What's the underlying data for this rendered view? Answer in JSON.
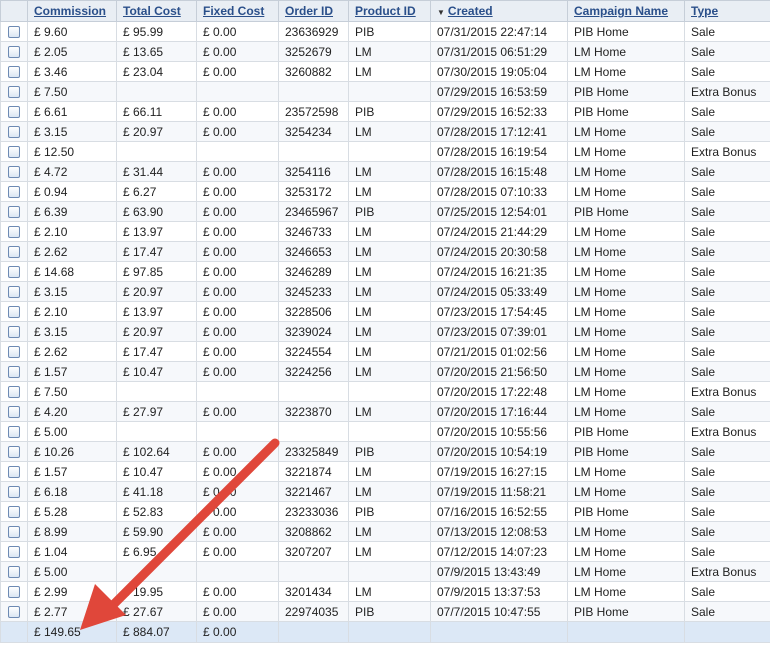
{
  "headers": {
    "commission": "Commission",
    "total_cost": "Total Cost",
    "fixed_cost": "Fixed Cost",
    "order_id": "Order ID",
    "product_id": "Product ID",
    "created": "Created",
    "campaign_name": "Campaign Name",
    "type": "Type"
  },
  "rows": [
    {
      "commission": "£ 9.60",
      "total_cost": "£ 95.99",
      "fixed_cost": "£ 0.00",
      "order_id": "23636929",
      "product_id": "PIB",
      "created": "07/31/2015 22:47:14",
      "campaign": "PIB Home",
      "type": "Sale"
    },
    {
      "commission": "£ 2.05",
      "total_cost": "£ 13.65",
      "fixed_cost": "£ 0.00",
      "order_id": "3252679",
      "product_id": "LM",
      "created": "07/31/2015 06:51:29",
      "campaign": "LM Home",
      "type": "Sale"
    },
    {
      "commission": "£ 3.46",
      "total_cost": "£ 23.04",
      "fixed_cost": "£ 0.00",
      "order_id": "3260882",
      "product_id": "LM",
      "created": "07/30/2015 19:05:04",
      "campaign": "LM Home",
      "type": "Sale"
    },
    {
      "commission": "£ 7.50",
      "total_cost": "",
      "fixed_cost": "",
      "order_id": "",
      "product_id": "",
      "created": "07/29/2015 16:53:59",
      "campaign": "PIB Home",
      "type": "Extra Bonus"
    },
    {
      "commission": "£ 6.61",
      "total_cost": "£ 66.11",
      "fixed_cost": "£ 0.00",
      "order_id": "23572598",
      "product_id": "PIB",
      "created": "07/29/2015 16:52:33",
      "campaign": "PIB Home",
      "type": "Sale"
    },
    {
      "commission": "£ 3.15",
      "total_cost": "£ 20.97",
      "fixed_cost": "£ 0.00",
      "order_id": "3254234",
      "product_id": "LM",
      "created": "07/28/2015 17:12:41",
      "campaign": "LM Home",
      "type": "Sale"
    },
    {
      "commission": "£ 12.50",
      "total_cost": "",
      "fixed_cost": "",
      "order_id": "",
      "product_id": "",
      "created": "07/28/2015 16:19:54",
      "campaign": "LM Home",
      "type": "Extra Bonus"
    },
    {
      "commission": "£ 4.72",
      "total_cost": "£ 31.44",
      "fixed_cost": "£ 0.00",
      "order_id": "3254116",
      "product_id": "LM",
      "created": "07/28/2015 16:15:48",
      "campaign": "LM Home",
      "type": "Sale"
    },
    {
      "commission": "£ 0.94",
      "total_cost": "£ 6.27",
      "fixed_cost": "£ 0.00",
      "order_id": "3253172",
      "product_id": "LM",
      "created": "07/28/2015 07:10:33",
      "campaign": "LM Home",
      "type": "Sale"
    },
    {
      "commission": "£ 6.39",
      "total_cost": "£ 63.90",
      "fixed_cost": "£ 0.00",
      "order_id": "23465967",
      "product_id": "PIB",
      "created": "07/25/2015 12:54:01",
      "campaign": "PIB Home",
      "type": "Sale"
    },
    {
      "commission": "£ 2.10",
      "total_cost": "£ 13.97",
      "fixed_cost": "£ 0.00",
      "order_id": "3246733",
      "product_id": "LM",
      "created": "07/24/2015 21:44:29",
      "campaign": "LM Home",
      "type": "Sale"
    },
    {
      "commission": "£ 2.62",
      "total_cost": "£ 17.47",
      "fixed_cost": "£ 0.00",
      "order_id": "3246653",
      "product_id": "LM",
      "created": "07/24/2015 20:30:58",
      "campaign": "LM Home",
      "type": "Sale"
    },
    {
      "commission": "£ 14.68",
      "total_cost": "£ 97.85",
      "fixed_cost": "£ 0.00",
      "order_id": "3246289",
      "product_id": "LM",
      "created": "07/24/2015 16:21:35",
      "campaign": "LM Home",
      "type": "Sale"
    },
    {
      "commission": "£ 3.15",
      "total_cost": "£ 20.97",
      "fixed_cost": "£ 0.00",
      "order_id": "3245233",
      "product_id": "LM",
      "created": "07/24/2015 05:33:49",
      "campaign": "LM Home",
      "type": "Sale"
    },
    {
      "commission": "£ 2.10",
      "total_cost": "£ 13.97",
      "fixed_cost": "£ 0.00",
      "order_id": "3228506",
      "product_id": "LM",
      "created": "07/23/2015 17:54:45",
      "campaign": "LM Home",
      "type": "Sale"
    },
    {
      "commission": "£ 3.15",
      "total_cost": "£ 20.97",
      "fixed_cost": "£ 0.00",
      "order_id": "3239024",
      "product_id": "LM",
      "created": "07/23/2015 07:39:01",
      "campaign": "LM Home",
      "type": "Sale"
    },
    {
      "commission": "£ 2.62",
      "total_cost": "£ 17.47",
      "fixed_cost": "£ 0.00",
      "order_id": "3224554",
      "product_id": "LM",
      "created": "07/21/2015 01:02:56",
      "campaign": "LM Home",
      "type": "Sale"
    },
    {
      "commission": "£ 1.57",
      "total_cost": "£ 10.47",
      "fixed_cost": "£ 0.00",
      "order_id": "3224256",
      "product_id": "LM",
      "created": "07/20/2015 21:56:50",
      "campaign": "LM Home",
      "type": "Sale"
    },
    {
      "commission": "£ 7.50",
      "total_cost": "",
      "fixed_cost": "",
      "order_id": "",
      "product_id": "",
      "created": "07/20/2015 17:22:48",
      "campaign": "LM Home",
      "type": "Extra Bonus"
    },
    {
      "commission": "£ 4.20",
      "total_cost": "£ 27.97",
      "fixed_cost": "£ 0.00",
      "order_id": "3223870",
      "product_id": "LM",
      "created": "07/20/2015 17:16:44",
      "campaign": "LM Home",
      "type": "Sale"
    },
    {
      "commission": "£ 5.00",
      "total_cost": "",
      "fixed_cost": "",
      "order_id": "",
      "product_id": "",
      "created": "07/20/2015 10:55:56",
      "campaign": "PIB Home",
      "type": "Extra Bonus"
    },
    {
      "commission": "£ 10.26",
      "total_cost": "£ 102.64",
      "fixed_cost": "£ 0.00",
      "order_id": "23325849",
      "product_id": "PIB",
      "created": "07/20/2015 10:54:19",
      "campaign": "PIB Home",
      "type": "Sale"
    },
    {
      "commission": "£ 1.57",
      "total_cost": "£ 10.47",
      "fixed_cost": "£ 0.00",
      "order_id": "3221874",
      "product_id": "LM",
      "created": "07/19/2015 16:27:15",
      "campaign": "LM Home",
      "type": "Sale"
    },
    {
      "commission": "£ 6.18",
      "total_cost": "£ 41.18",
      "fixed_cost": "£ 0.00",
      "order_id": "3221467",
      "product_id": "LM",
      "created": "07/19/2015 11:58:21",
      "campaign": "LM Home",
      "type": "Sale"
    },
    {
      "commission": "£ 5.28",
      "total_cost": "£ 52.83",
      "fixed_cost": "£ 0.00",
      "order_id": "23233036",
      "product_id": "PIB",
      "created": "07/16/2015 16:52:55",
      "campaign": "PIB Home",
      "type": "Sale"
    },
    {
      "commission": "£ 8.99",
      "total_cost": "£ 59.90",
      "fixed_cost": "£ 0.00",
      "order_id": "3208862",
      "product_id": "LM",
      "created": "07/13/2015 12:08:53",
      "campaign": "LM Home",
      "type": "Sale"
    },
    {
      "commission": "£ 1.04",
      "total_cost": "£ 6.95",
      "fixed_cost": "£ 0.00",
      "order_id": "3207207",
      "product_id": "LM",
      "created": "07/12/2015 14:07:23",
      "campaign": "LM Home",
      "type": "Sale"
    },
    {
      "commission": "£ 5.00",
      "total_cost": "",
      "fixed_cost": "",
      "order_id": "",
      "product_id": "",
      "created": "07/9/2015 13:43:49",
      "campaign": "LM Home",
      "type": "Extra Bonus"
    },
    {
      "commission": "£ 2.99",
      "total_cost": "£ 19.95",
      "fixed_cost": "£ 0.00",
      "order_id": "3201434",
      "product_id": "LM",
      "created": "07/9/2015 13:37:53",
      "campaign": "LM Home",
      "type": "Sale"
    },
    {
      "commission": "£ 2.77",
      "total_cost": "£ 27.67",
      "fixed_cost": "£ 0.00",
      "order_id": "22974035",
      "product_id": "PIB",
      "created": "07/7/2015 10:47:55",
      "campaign": "PIB Home",
      "type": "Sale"
    }
  ],
  "totals": {
    "commission": "£ 149.65",
    "total_cost": "£ 884.07",
    "fixed_cost": "£ 0.00"
  },
  "icons": {
    "sort": "sort-descending-icon",
    "row_select": "checkbox-icon",
    "annotation": "red-arrow-annotation"
  },
  "colors": {
    "header_text": "#2a4f8a",
    "header_bg": "#e9eef4",
    "footer_bg": "#dce8f6",
    "arrow": "#e0473a"
  }
}
